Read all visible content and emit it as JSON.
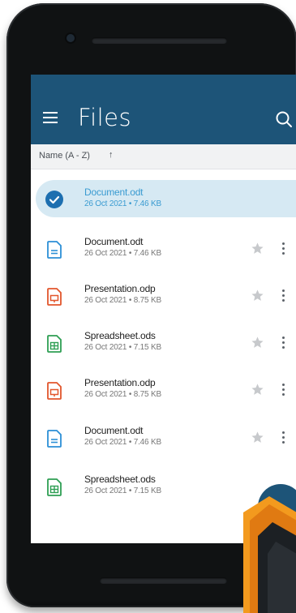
{
  "app": {
    "title": "Files",
    "sort_label": "Name (A - Z)",
    "sort_arrow": "↑"
  },
  "colors": {
    "app_bar": "#1d5478",
    "selected_bg": "#d6e9f3",
    "selected_text": "#3a9bd1",
    "document_icon": "#2c8fd6",
    "presentation_icon": "#e2562c",
    "spreadsheet_icon": "#2e9e53"
  },
  "files": [
    {
      "name": "Document.odt",
      "meta": "26 Oct 2021 • 7.46 KB",
      "icon": "document-icon",
      "selected": true
    },
    {
      "name": "Document.odt",
      "meta": "26 Oct 2021 • 7.46 KB",
      "icon": "document-icon"
    },
    {
      "name": "Presentation.odp",
      "meta": "26 Oct 2021 • 8.75 KB",
      "icon": "presentation-icon"
    },
    {
      "name": "Spreadsheet.ods",
      "meta": "26 Oct 2021 • 7.15 KB",
      "icon": "spreadsheet-icon"
    },
    {
      "name": "Presentation.odp",
      "meta": "26 Oct 2021 • 8.75 KB",
      "icon": "presentation-icon"
    },
    {
      "name": "Document.odt",
      "meta": "26 Oct 2021 • 7.46 KB",
      "icon": "document-icon"
    },
    {
      "name": "Spreadsheet.ods",
      "meta": "26 Oct 2021 • 7.15 KB",
      "icon": "spreadsheet-icon"
    }
  ]
}
